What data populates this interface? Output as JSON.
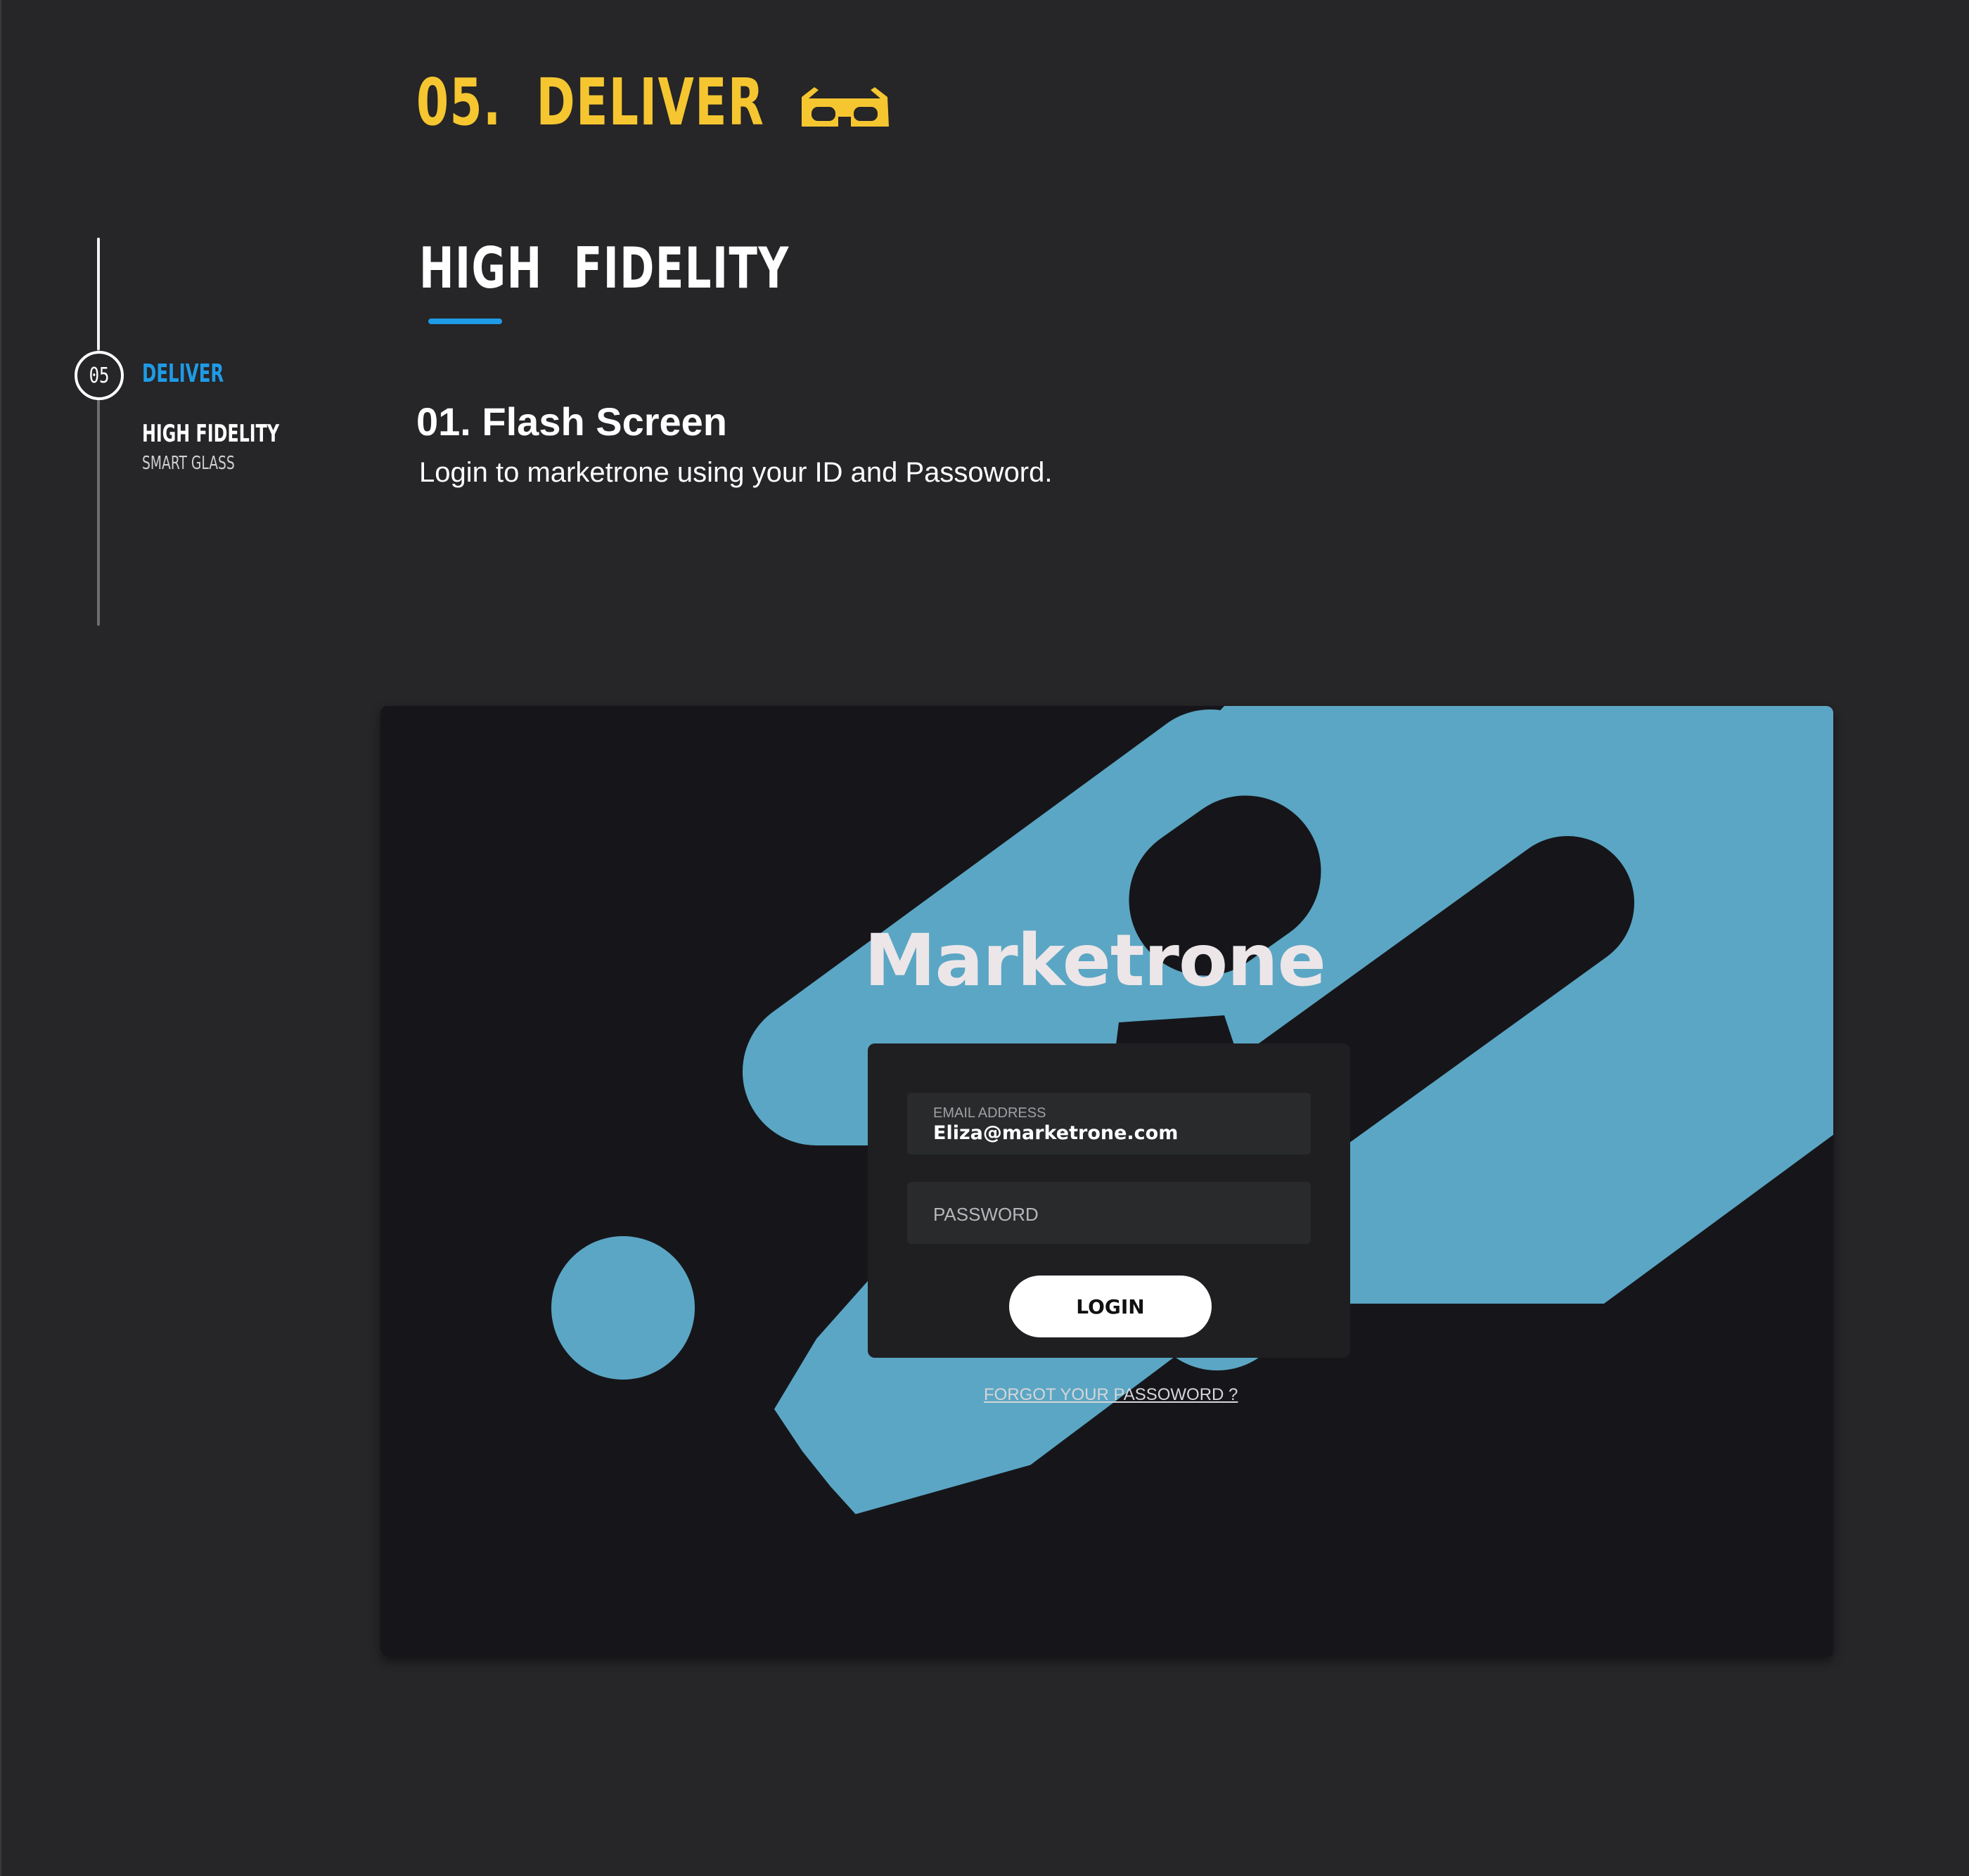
{
  "header": {
    "section_title": "05.  DELIVER",
    "section_icon": "3d-glasses-icon",
    "page_title": "HIGH  FIDELITY"
  },
  "sidebar": {
    "step_number": "05",
    "active_label": "DELIVER",
    "item_label": "HIGH FIDELITY",
    "item_sublabel": "SMART GLASS"
  },
  "step": {
    "heading": "01. Flash Screen",
    "description": "Login to marketrone using your ID and Passoword."
  },
  "mockup": {
    "brand_name": "Marketrone",
    "email": {
      "label": "EMAIL ADDRESS",
      "value": "Eliza@marketrone.com"
    },
    "password": {
      "placeholder": "PASSWORD"
    },
    "login_label": "LOGIN",
    "forgot_label": "FORGOT YOUR PASSOWORD ?"
  },
  "colors": {
    "page_background": "#262527",
    "accent_yellow": "#F5C630",
    "accent_blue": "#1E9BE6",
    "mockup_background": "#16161a",
    "mockup_shape_blue": "#5BA6C4"
  }
}
